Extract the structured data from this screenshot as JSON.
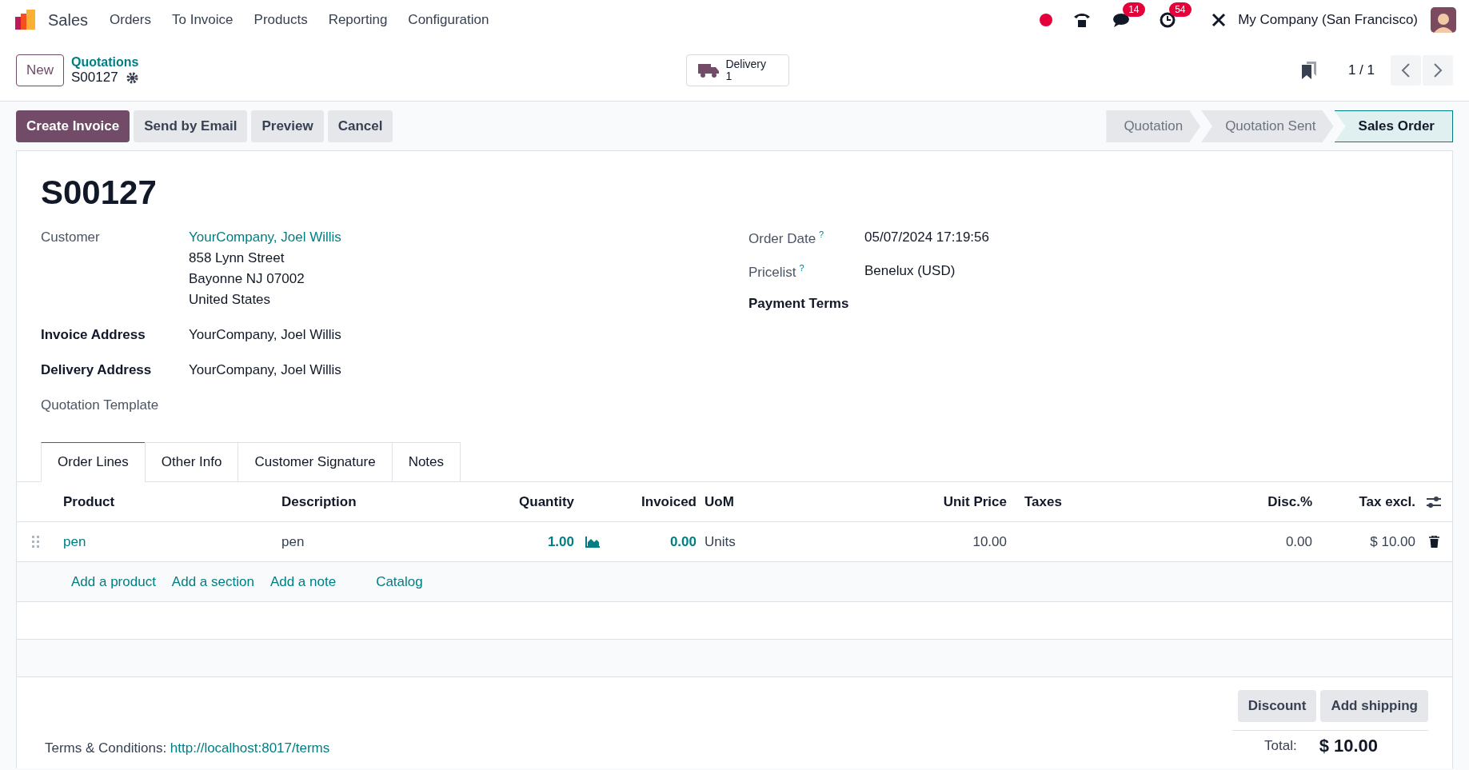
{
  "navbar": {
    "app_name": "Sales",
    "menu": [
      "Orders",
      "To Invoice",
      "Products",
      "Reporting",
      "Configuration"
    ],
    "messages_badge": "14",
    "activities_badge": "54",
    "company": "My Company (San Francisco)"
  },
  "control_panel": {
    "new_button": "New",
    "breadcrumb": "Quotations",
    "record": "S00127",
    "smart_button": {
      "label": "Delivery",
      "count": "1"
    },
    "pager": "1 / 1"
  },
  "actions": [
    {
      "label": "Create Invoice",
      "kind": "primary"
    },
    {
      "label": "Send by Email",
      "kind": "secondary"
    },
    {
      "label": "Preview",
      "kind": "secondary"
    },
    {
      "label": "Cancel",
      "kind": "secondary"
    }
  ],
  "statusbar": [
    {
      "label": "Quotation",
      "selected": false
    },
    {
      "label": "Quotation Sent",
      "selected": false
    },
    {
      "label": "Sales Order",
      "selected": true
    }
  ],
  "form": {
    "title": "S00127",
    "left_fields": [
      {
        "label": "Customer",
        "bold": false,
        "lines": [
          "YourCompany, Joel Willis",
          "858 Lynn Street",
          "Bayonne NJ 07002",
          "United States"
        ]
      },
      {
        "label": "Invoice Address",
        "bold": true,
        "lines": [
          "YourCompany, Joel Willis"
        ]
      },
      {
        "label": "Delivery Address",
        "bold": true,
        "lines": [
          "YourCompany, Joel Willis"
        ]
      },
      {
        "label": "Quotation Template",
        "bold": false
      }
    ],
    "right_fields": [
      {
        "label": "Order Date",
        "help": "?",
        "bold": false,
        "value": "05/07/2024 17:19:56"
      },
      {
        "label": "Pricelist",
        "help": "?",
        "bold": false,
        "value": "Benelux (USD)"
      },
      {
        "label": "Payment Terms",
        "bold": true
      }
    ]
  },
  "tabs": [
    {
      "label": "Order Lines",
      "selected": true
    },
    {
      "label": "Other Info",
      "selected": false
    },
    {
      "label": "Customer Signature",
      "selected": false
    },
    {
      "label": "Notes",
      "selected": false
    }
  ],
  "table": {
    "columns": [
      "Product",
      "Description",
      "Quantity",
      "Invoiced",
      "UoM",
      "Unit Price",
      "Taxes",
      "Disc.%",
      "Tax excl."
    ],
    "rows": [
      {
        "product": "pen",
        "description": "pen",
        "quantity": "1.00",
        "invoiced": "0.00",
        "uom": "Units",
        "unit_price": "10.00",
        "disc": "0.00",
        "subtotal": "$ 10.00"
      }
    ],
    "add_links": [
      "Add a product",
      "Add a section",
      "Add a note",
      "Catalog"
    ]
  },
  "footer": {
    "terms_label": "Terms & Conditions:",
    "terms_link": "http://localhost:8017/terms",
    "buttons": [
      "Discount",
      "Add shipping"
    ],
    "total_label": "Total:",
    "total_value": "$ 10.00"
  }
}
